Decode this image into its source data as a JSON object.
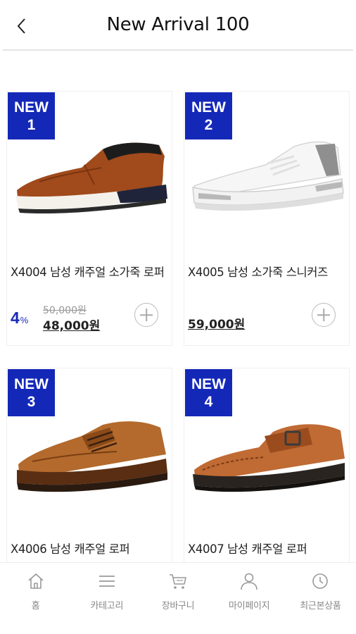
{
  "header": {
    "title": "New Arrival 100"
  },
  "products": [
    {
      "badge_top": "NEW",
      "badge_num": "1",
      "name": "X4004 남성 캐주얼 소가죽 로퍼",
      "discount": "4",
      "discount_unit": "%",
      "original_price": "50,000원",
      "price": "48,000원",
      "image": "brown-leather-loafer"
    },
    {
      "badge_top": "NEW",
      "badge_num": "2",
      "name": "X4005 남성 소가죽 스니커즈",
      "discount": "",
      "discount_unit": "",
      "original_price": "",
      "price": "59,000원",
      "image": "white-leather-sneaker"
    },
    {
      "badge_top": "NEW",
      "badge_num": "3",
      "name": "X4006 남성 캐주얼 로퍼",
      "image": "tan-lace-up-shoe"
    },
    {
      "badge_top": "NEW",
      "badge_num": "4",
      "name": "X4007 남성 캐주얼 로퍼",
      "image": "brown-strap-moccasin"
    }
  ],
  "tabbar": [
    {
      "label": "홈",
      "icon": "home-icon"
    },
    {
      "label": "카테고리",
      "icon": "menu-icon"
    },
    {
      "label": "장바구니",
      "icon": "cart-icon"
    },
    {
      "label": "마이페이지",
      "icon": "user-icon"
    },
    {
      "label": "최근본상품",
      "icon": "clock-icon"
    }
  ],
  "colors": {
    "badge": "#1428b8",
    "discount": "#1a2bb5",
    "tab_icon": "#999999"
  }
}
